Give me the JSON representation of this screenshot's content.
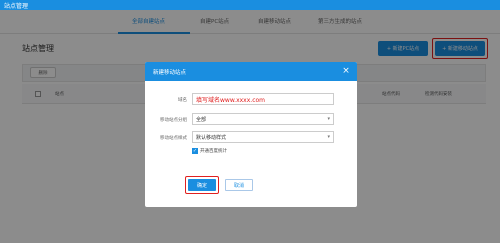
{
  "window": {
    "title": "站点管理"
  },
  "tabs": [
    {
      "label": "全部自建站点",
      "active": true
    },
    {
      "label": "自建PC站点",
      "active": false
    },
    {
      "label": "自建移动站点",
      "active": false
    },
    {
      "label": "第三方生成的站点",
      "active": false
    }
  ],
  "page": {
    "title": "站点管理",
    "new_pc_button": "+ 新建PC站点",
    "new_mobile_button": "+ 新建移动站点",
    "delete_button": "删除"
  },
  "table": {
    "headers": [
      "站点",
      "站点代码",
      "检测代码安装"
    ]
  },
  "dialog": {
    "title": "新建移动站点",
    "close_icon": "close-icon",
    "fields": {
      "domain_label": "域名",
      "domain_value": "填写域名www.xxxx.com",
      "group_label": "移动站点分组",
      "group_value": "全部",
      "style_label": "移动站点样式",
      "style_value": "默认移动样式",
      "baidu_stats_label": "开通百度统计",
      "baidu_stats_checked": true
    },
    "ok_button": "确定",
    "cancel_button": "取消"
  },
  "colors": {
    "accent": "#1a8ee0",
    "highlight": "#e02020"
  }
}
